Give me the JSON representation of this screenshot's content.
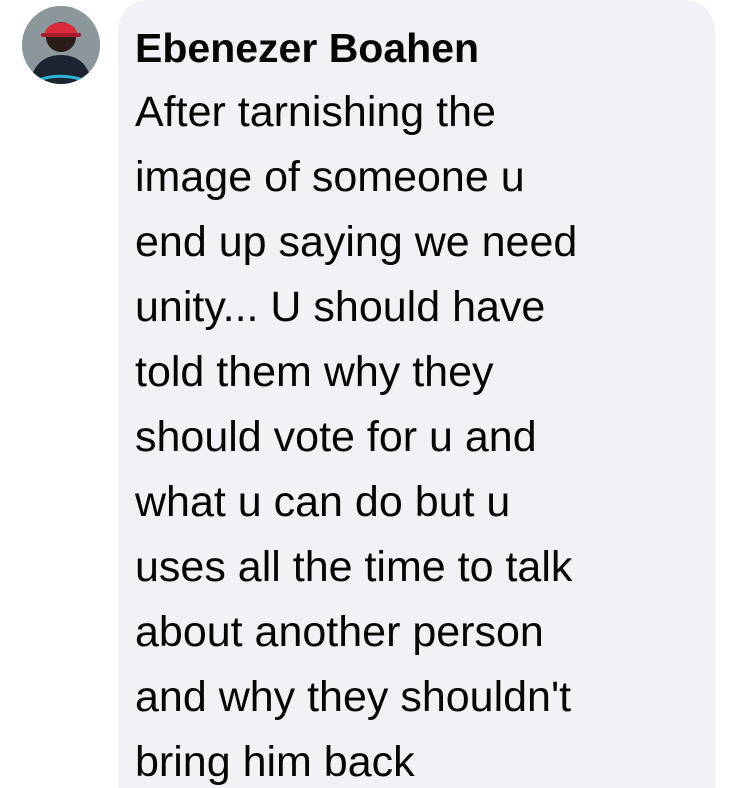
{
  "comment": {
    "author": "Ebenezer Boahen",
    "text_lines": [
      "After tarnishing the",
      "image of someone u",
      "end up saying we need",
      "unity... U should have",
      "told them why they",
      "should vote for u and",
      "what u can do but u",
      "uses all the time to talk",
      "about another person",
      "and why they shouldn't",
      "bring him back"
    ],
    "avatar_icon": "profile-photo",
    "colors": {
      "bubble_background": "#f0f2f5",
      "text": "#050505",
      "avatar_cap": "#d92b3a",
      "avatar_shirt": "#1c2331"
    }
  }
}
